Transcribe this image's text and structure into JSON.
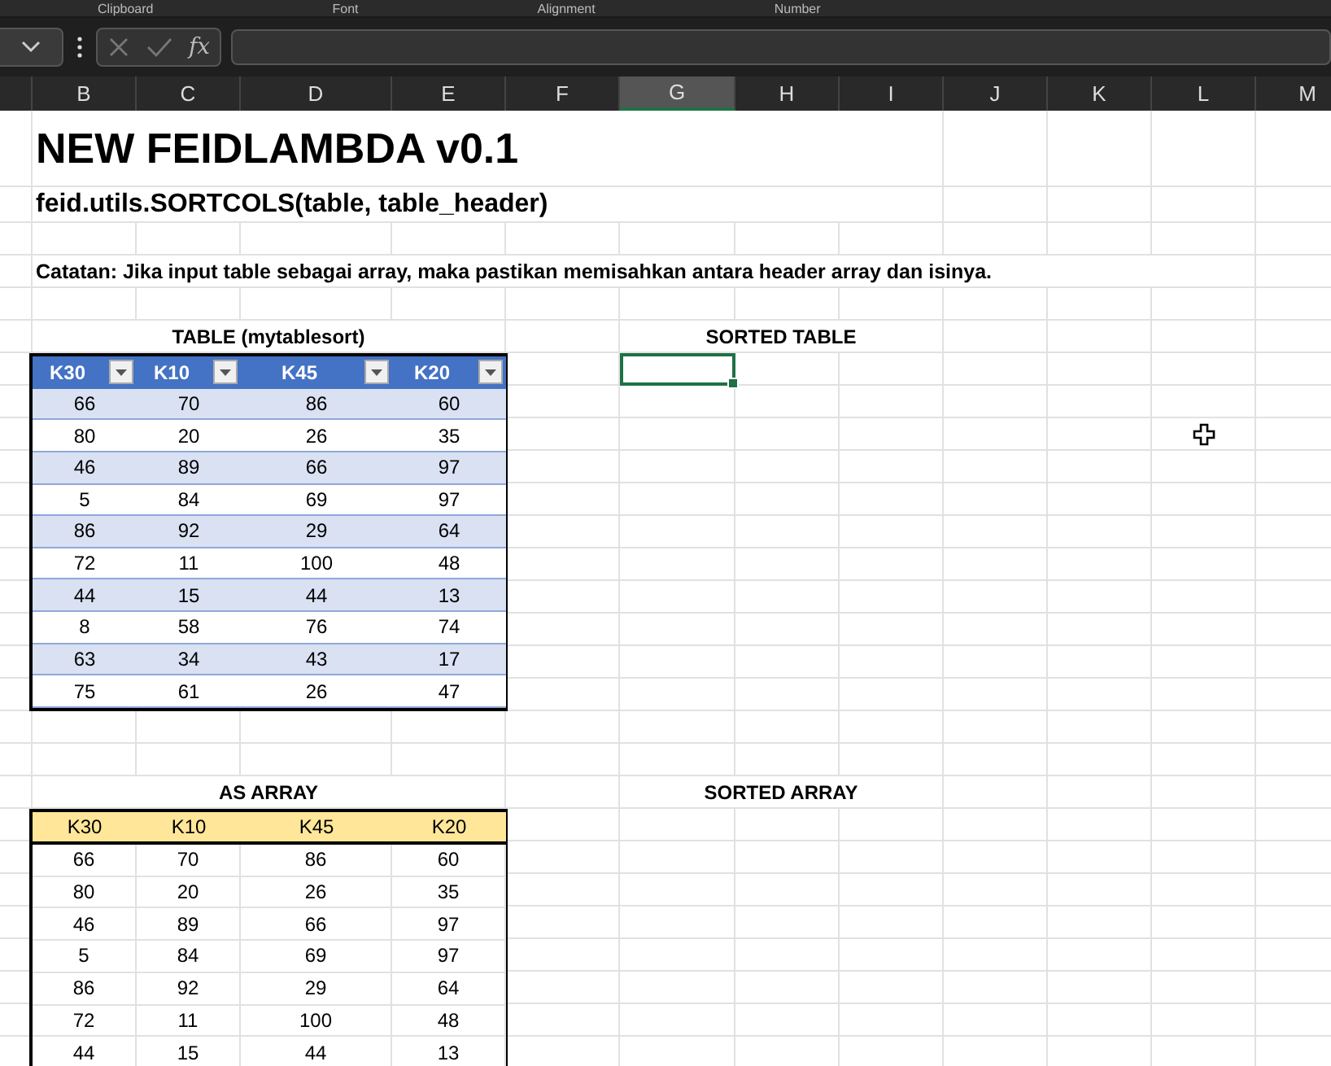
{
  "ribbon_groups": [
    "Clipboard",
    "Font",
    "Alignment",
    "Number"
  ],
  "formula_bar": {
    "fx_label": "fx"
  },
  "column_headers": [
    {
      "selected": false
    },
    {
      "label": "B",
      "selected": false
    },
    {
      "label": "C",
      "selected": false
    },
    {
      "label": "D",
      "selected": false
    },
    {
      "label": "E",
      "selected": false
    },
    {
      "label": "F",
      "selected": false
    },
    {
      "label": "G",
      "selected": true
    },
    {
      "label": "H",
      "selected": false
    },
    {
      "label": "I",
      "selected": false
    },
    {
      "label": "J",
      "selected": false
    },
    {
      "label": "K",
      "selected": false
    },
    {
      "label": "L",
      "selected": false
    },
    {
      "label": "M",
      "selected": false
    }
  ],
  "sheet": {
    "title": "NEW FEIDLAMBDA v0.1",
    "subtitle": "feid.utils.SORTCOLS(table, table_header)",
    "note": "Catatan: Jika input table sebagai array, maka pastikan memisahkan antara header array dan isinya."
  },
  "table": {
    "title": "TABLE (mytablesort)",
    "columns": [
      "K30",
      "K10",
      "K45",
      "K20"
    ],
    "rows": [
      [
        "66",
        "70",
        "86",
        "60"
      ],
      [
        "80",
        "20",
        "26",
        "35"
      ],
      [
        "46",
        "89",
        "66",
        "97"
      ],
      [
        "5",
        "84",
        "69",
        "97"
      ],
      [
        "86",
        "92",
        "29",
        "64"
      ],
      [
        "72",
        "11",
        "100",
        "48"
      ],
      [
        "44",
        "15",
        "44",
        "13"
      ],
      [
        "8",
        "58",
        "76",
        "74"
      ],
      [
        "63",
        "34",
        "43",
        "17"
      ],
      [
        "75",
        "61",
        "26",
        "47"
      ]
    ]
  },
  "sorted_table": {
    "title": "SORTED TABLE"
  },
  "array": {
    "title": "AS ARRAY",
    "columns": [
      "K30",
      "K10",
      "K45",
      "K20"
    ],
    "rows": [
      [
        "66",
        "70",
        "86",
        "60"
      ],
      [
        "80",
        "20",
        "26",
        "35"
      ],
      [
        "46",
        "89",
        "66",
        "97"
      ],
      [
        "5",
        "84",
        "69",
        "97"
      ],
      [
        "86",
        "92",
        "29",
        "64"
      ],
      [
        "72",
        "11",
        "100",
        "48"
      ],
      [
        "44",
        "15",
        "44",
        "13"
      ]
    ]
  },
  "sorted_array": {
    "title": "SORTED ARRAY"
  }
}
